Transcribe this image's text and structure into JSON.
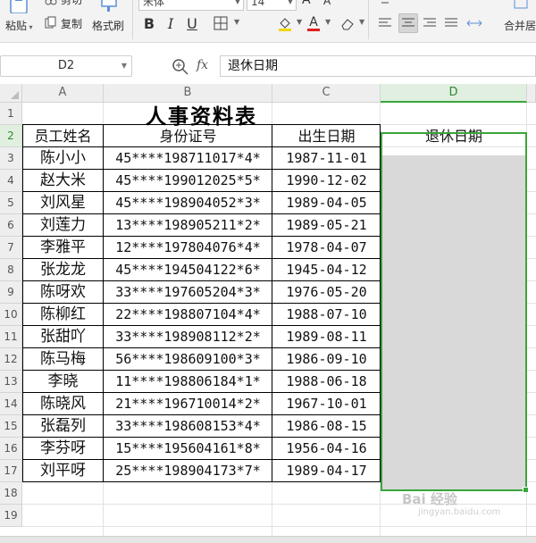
{
  "ribbon": {
    "paste_label": "粘贴",
    "cut_label": "剪切",
    "copy_label": "复制",
    "format_painter_label": "格式刷",
    "font_name": "宋体",
    "font_size": "14",
    "bold": "B",
    "italic": "I",
    "underline": "U",
    "font_color_letter": "A",
    "merge_center_label": "合并居"
  },
  "formula_bar": {
    "cell_ref": "D2",
    "fx_label": "fx",
    "formula": "退休日期"
  },
  "sheet": {
    "columns": [
      "A",
      "B",
      "C",
      "D"
    ],
    "selected_column": "D",
    "rows": [
      "1",
      "2",
      "3",
      "4",
      "5",
      "6",
      "7",
      "8",
      "9",
      "10",
      "11",
      "12",
      "13",
      "14",
      "15",
      "16",
      "17",
      "18",
      "19"
    ],
    "title": "人事资料表",
    "headers": [
      "员工姓名",
      "身份证号",
      "出生日期",
      "退休日期"
    ],
    "records": [
      {
        "name": "陈小小",
        "id": "45****198711017*4*",
        "birth": "1987-11-01"
      },
      {
        "name": "赵大米",
        "id": "45****199012025*5*",
        "birth": "1990-12-02"
      },
      {
        "name": "刘风星",
        "id": "45****198904052*3*",
        "birth": "1989-04-05"
      },
      {
        "name": "刘莲力",
        "id": "13****198905211*2*",
        "birth": "1989-05-21"
      },
      {
        "name": "李雅平",
        "id": "12****197804076*4*",
        "birth": "1978-04-07"
      },
      {
        "name": "张龙龙",
        "id": "45****194504122*6*",
        "birth": "1945-04-12"
      },
      {
        "name": "陈呀欢",
        "id": "33****197605204*3*",
        "birth": "1976-05-20"
      },
      {
        "name": "陈柳红",
        "id": "22****198807104*4*",
        "birth": "1988-07-10"
      },
      {
        "name": "张甜吖",
        "id": "33****198908112*2*",
        "birth": "1989-08-11"
      },
      {
        "name": "陈马梅",
        "id": "56****198609100*3*",
        "birth": "1986-09-10"
      },
      {
        "name": "李晓",
        "id": "11****198806184*1*",
        "birth": "1988-06-18"
      },
      {
        "name": "陈晓风",
        "id": "21****196710014*2*",
        "birth": "1967-10-01"
      },
      {
        "name": "张磊列",
        "id": "33****198608153*4*",
        "birth": "1986-08-15"
      },
      {
        "name": "李芬呀",
        "id": "15****195604161*8*",
        "birth": "1956-04-16"
      },
      {
        "name": "刘平呀",
        "id": "25****198904173*7*",
        "birth": "1989-04-17"
      }
    ]
  },
  "watermark": {
    "text": "Bai 经验",
    "sub": "jingyan.baidu.com"
  },
  "colors": {
    "selection": "#3aa53a",
    "retire_fill": "#d9d9d9"
  }
}
